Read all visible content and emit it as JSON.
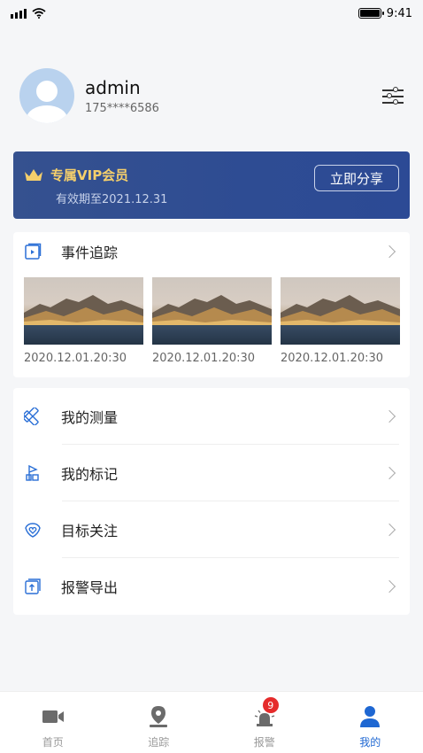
{
  "status_bar": {
    "time": "9:41"
  },
  "profile": {
    "username": "admin",
    "phone": "175****6586"
  },
  "vip": {
    "title": "专属VIP会员",
    "expiry": "有效期至2021.12.31",
    "share_label": "立即分享"
  },
  "event_tracking": {
    "label": "事件追踪",
    "items": [
      {
        "date": "2020.12.01.20:30"
      },
      {
        "date": "2020.12.01.20:30"
      },
      {
        "date": "2020.12.01.20:30"
      }
    ]
  },
  "menu": [
    {
      "label": "我的测量",
      "icon": "measure-icon"
    },
    {
      "label": "我的标记",
      "icon": "flag-marker-icon"
    },
    {
      "label": "目标关注",
      "icon": "heart-shield-icon"
    },
    {
      "label": "报警导出",
      "icon": "export-icon"
    }
  ],
  "tabs": [
    {
      "label": "首页",
      "icon": "video-camera-icon"
    },
    {
      "label": "追踪",
      "icon": "location-pin-icon"
    },
    {
      "label": "报警",
      "icon": "alarm-light-icon",
      "badge": "9"
    },
    {
      "label": "我的",
      "icon": "user-icon",
      "active": true
    }
  ],
  "colors": {
    "accent": "#1e67d2",
    "vip_gold": "#f5cf6b",
    "vip_bg": "#2e4c93",
    "badge": "#e52b2b"
  }
}
